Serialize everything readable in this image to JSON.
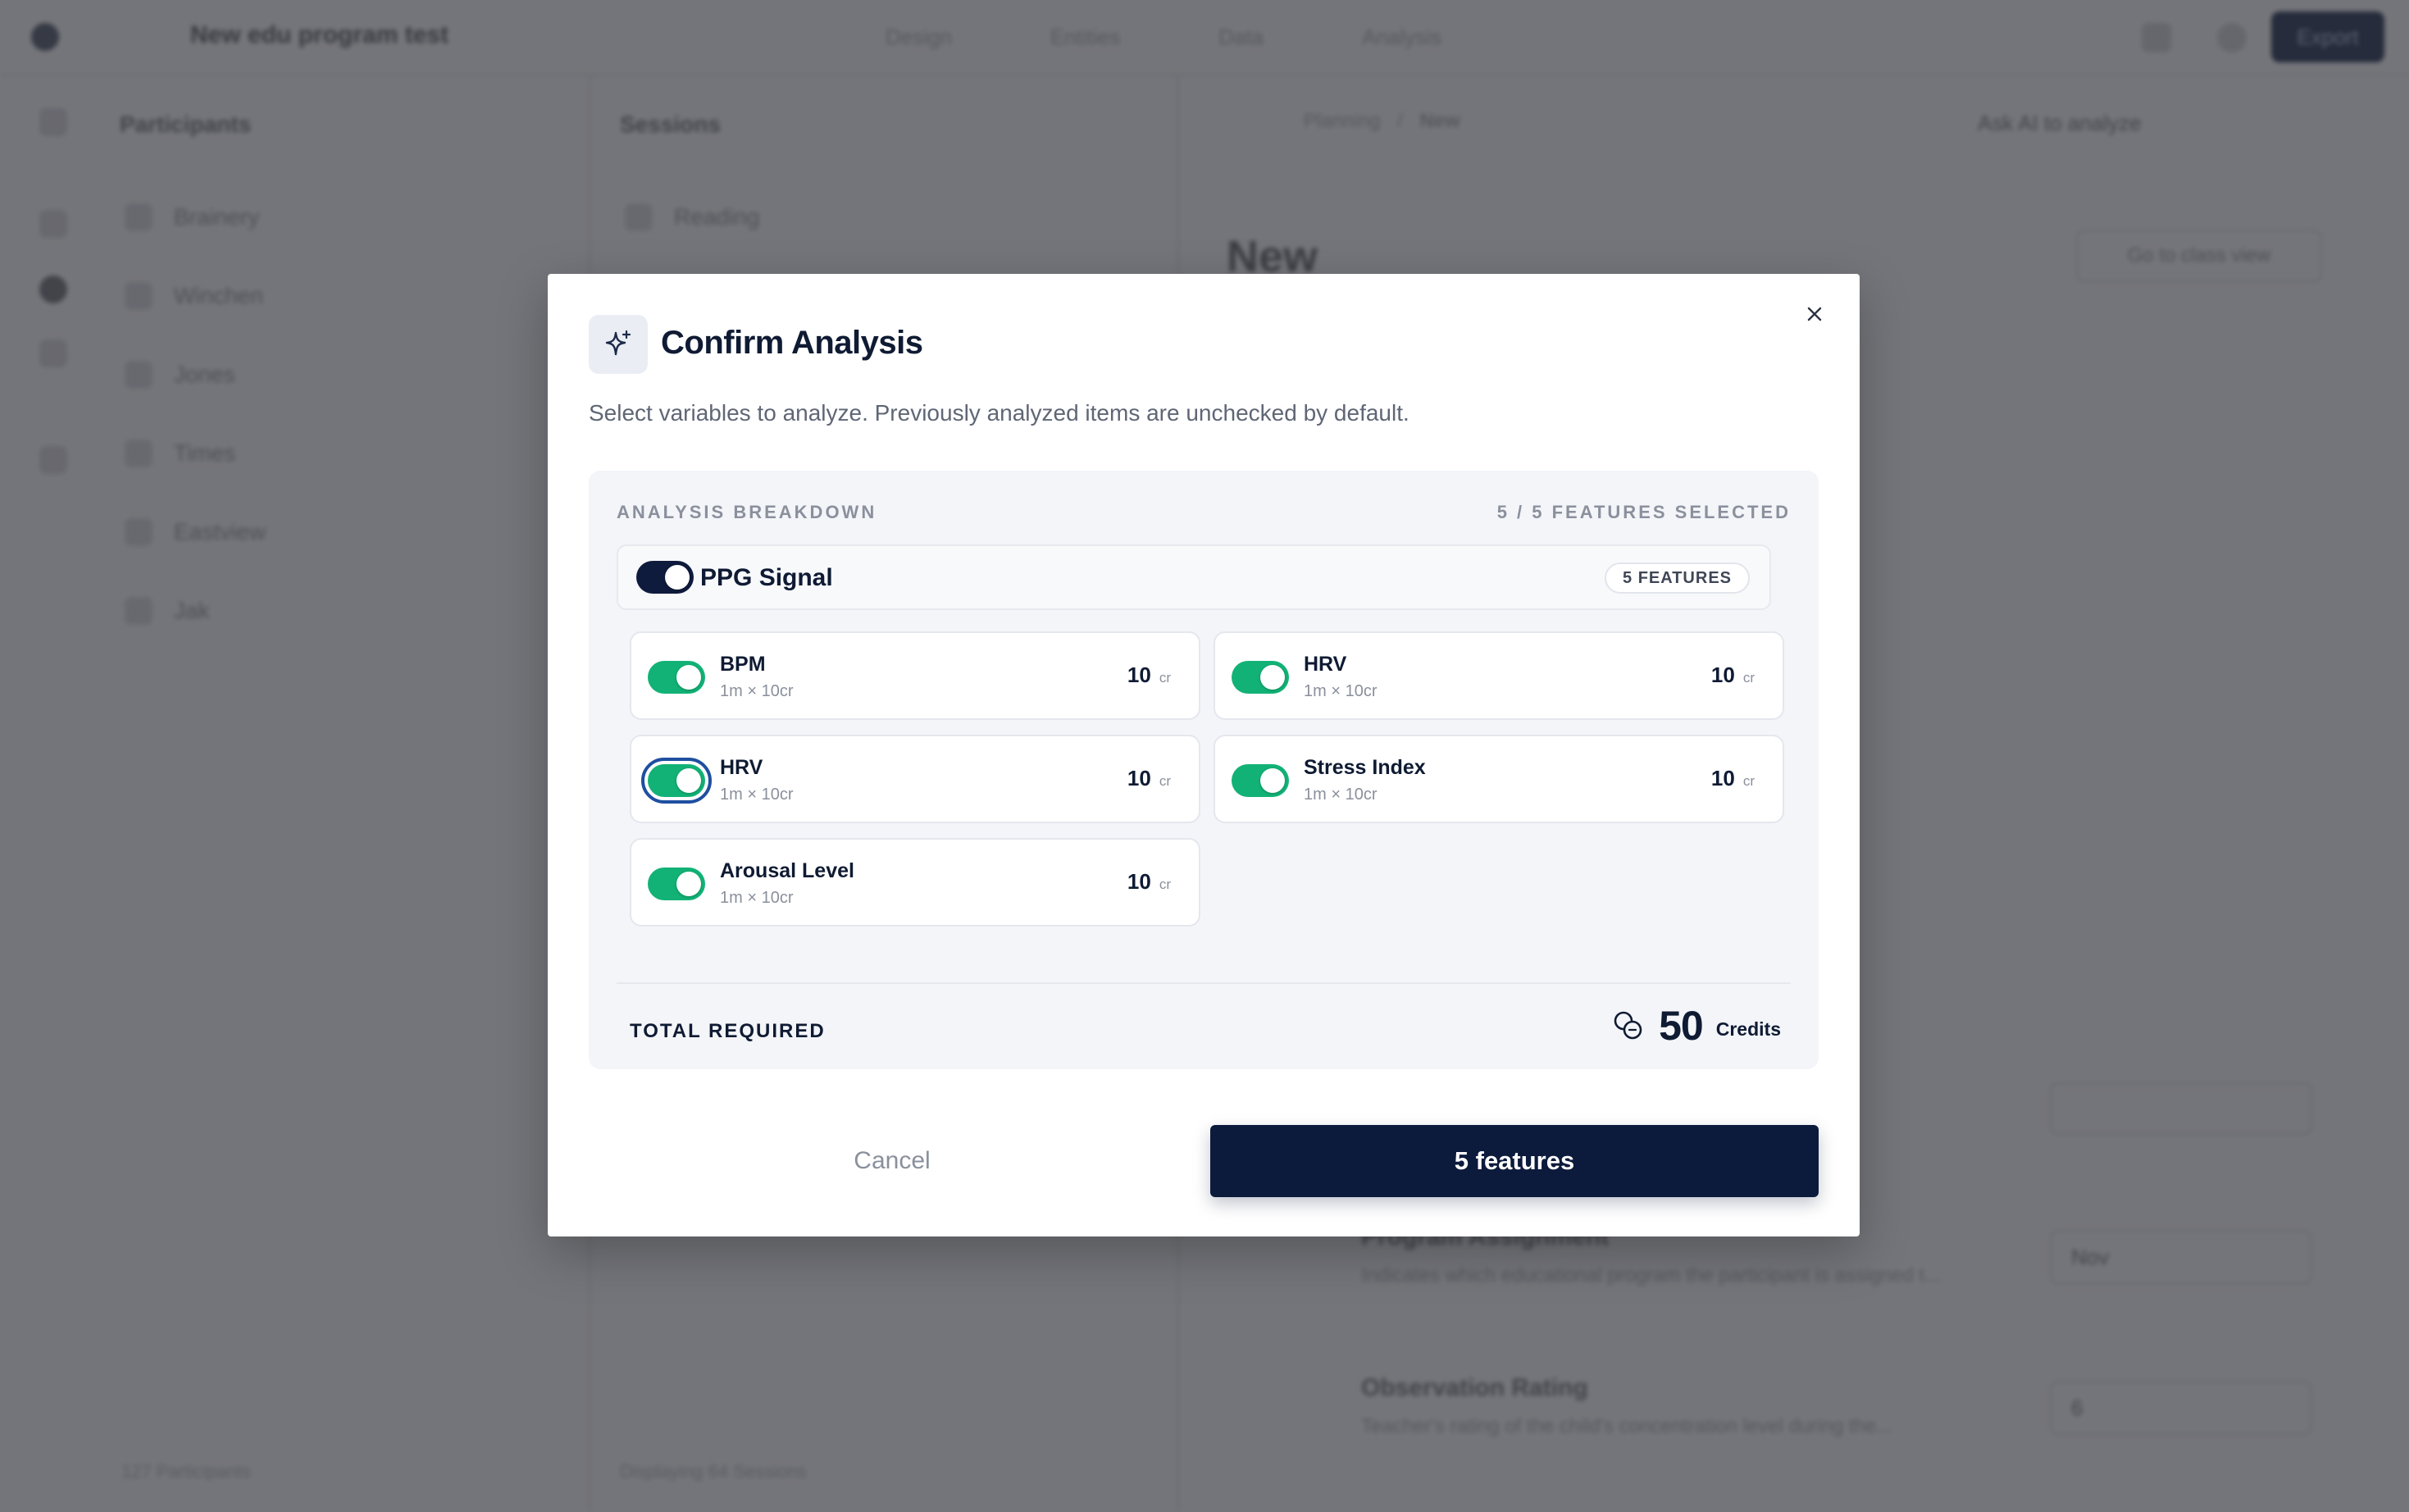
{
  "background": {
    "project_title": "New edu program test",
    "top_tabs": [
      "Design",
      "Entities",
      "Data",
      "Analysis"
    ],
    "export_label": "Export",
    "participants_title": "Participants",
    "participants": [
      "Brainery",
      "Winchen",
      "Jones",
      "Times",
      "Eastview",
      "Jak"
    ],
    "participants_footer": "127 Participants",
    "sessions_title": "Sessions",
    "sessions": [
      "Reading"
    ],
    "sessions_footer": "Displaying 64 Sessions",
    "breadcrumb_parent": "Planning",
    "breadcrumb_current": "New",
    "page_title": "New",
    "ask_ai_label": "Ask AI to analyze",
    "go_to_view_label": "Go to class view",
    "field_program_assignment": "Program Assignment",
    "field_program_desc": "Indicates which educational program the participant is assigned t...",
    "field_program_value": "Nov",
    "field_observation": "Observation Rating",
    "field_observation_desc": "Teacher's rating of the child's concentration level during the...",
    "field_observation_value": "6"
  },
  "modal": {
    "title": "Confirm Analysis",
    "subtitle": "Select variables to analyze. Previously analyzed items are unchecked by default.",
    "breakdown_label": "ANALYSIS BREAKDOWN",
    "selected_label": "5 / 5 FEATURES SELECTED",
    "group": {
      "name": "PPG Signal",
      "badge": "5 FEATURES",
      "enabled": true
    },
    "features": [
      {
        "name": "BPM",
        "meta": "1m × 10cr",
        "cost": "10",
        "unit": "cr",
        "enabled": true
      },
      {
        "name": "HRV",
        "meta": "1m × 10cr",
        "cost": "10",
        "unit": "cr",
        "enabled": true
      },
      {
        "name": "HRV",
        "meta": "1m × 10cr",
        "cost": "10",
        "unit": "cr",
        "enabled": true
      },
      {
        "name": "Stress Index",
        "meta": "1m × 10cr",
        "cost": "10",
        "unit": "cr",
        "enabled": true
      },
      {
        "name": "Arousal Level",
        "meta": "1m × 10cr",
        "cost": "10",
        "unit": "cr",
        "enabled": true
      }
    ],
    "total_label": "TOTAL REQUIRED",
    "total_value": "50",
    "total_unit": "Credits",
    "cancel_label": "Cancel",
    "confirm_label": "5 features"
  },
  "colors": {
    "primary_navy": "#0c1a3c",
    "toggle_green": "#12b276",
    "focus_ring": "#1e4fa0",
    "muted_text": "#8a909c"
  },
  "icons": {
    "header": "sparkle-icon",
    "close": "close-icon",
    "credits": "coins-icon"
  }
}
